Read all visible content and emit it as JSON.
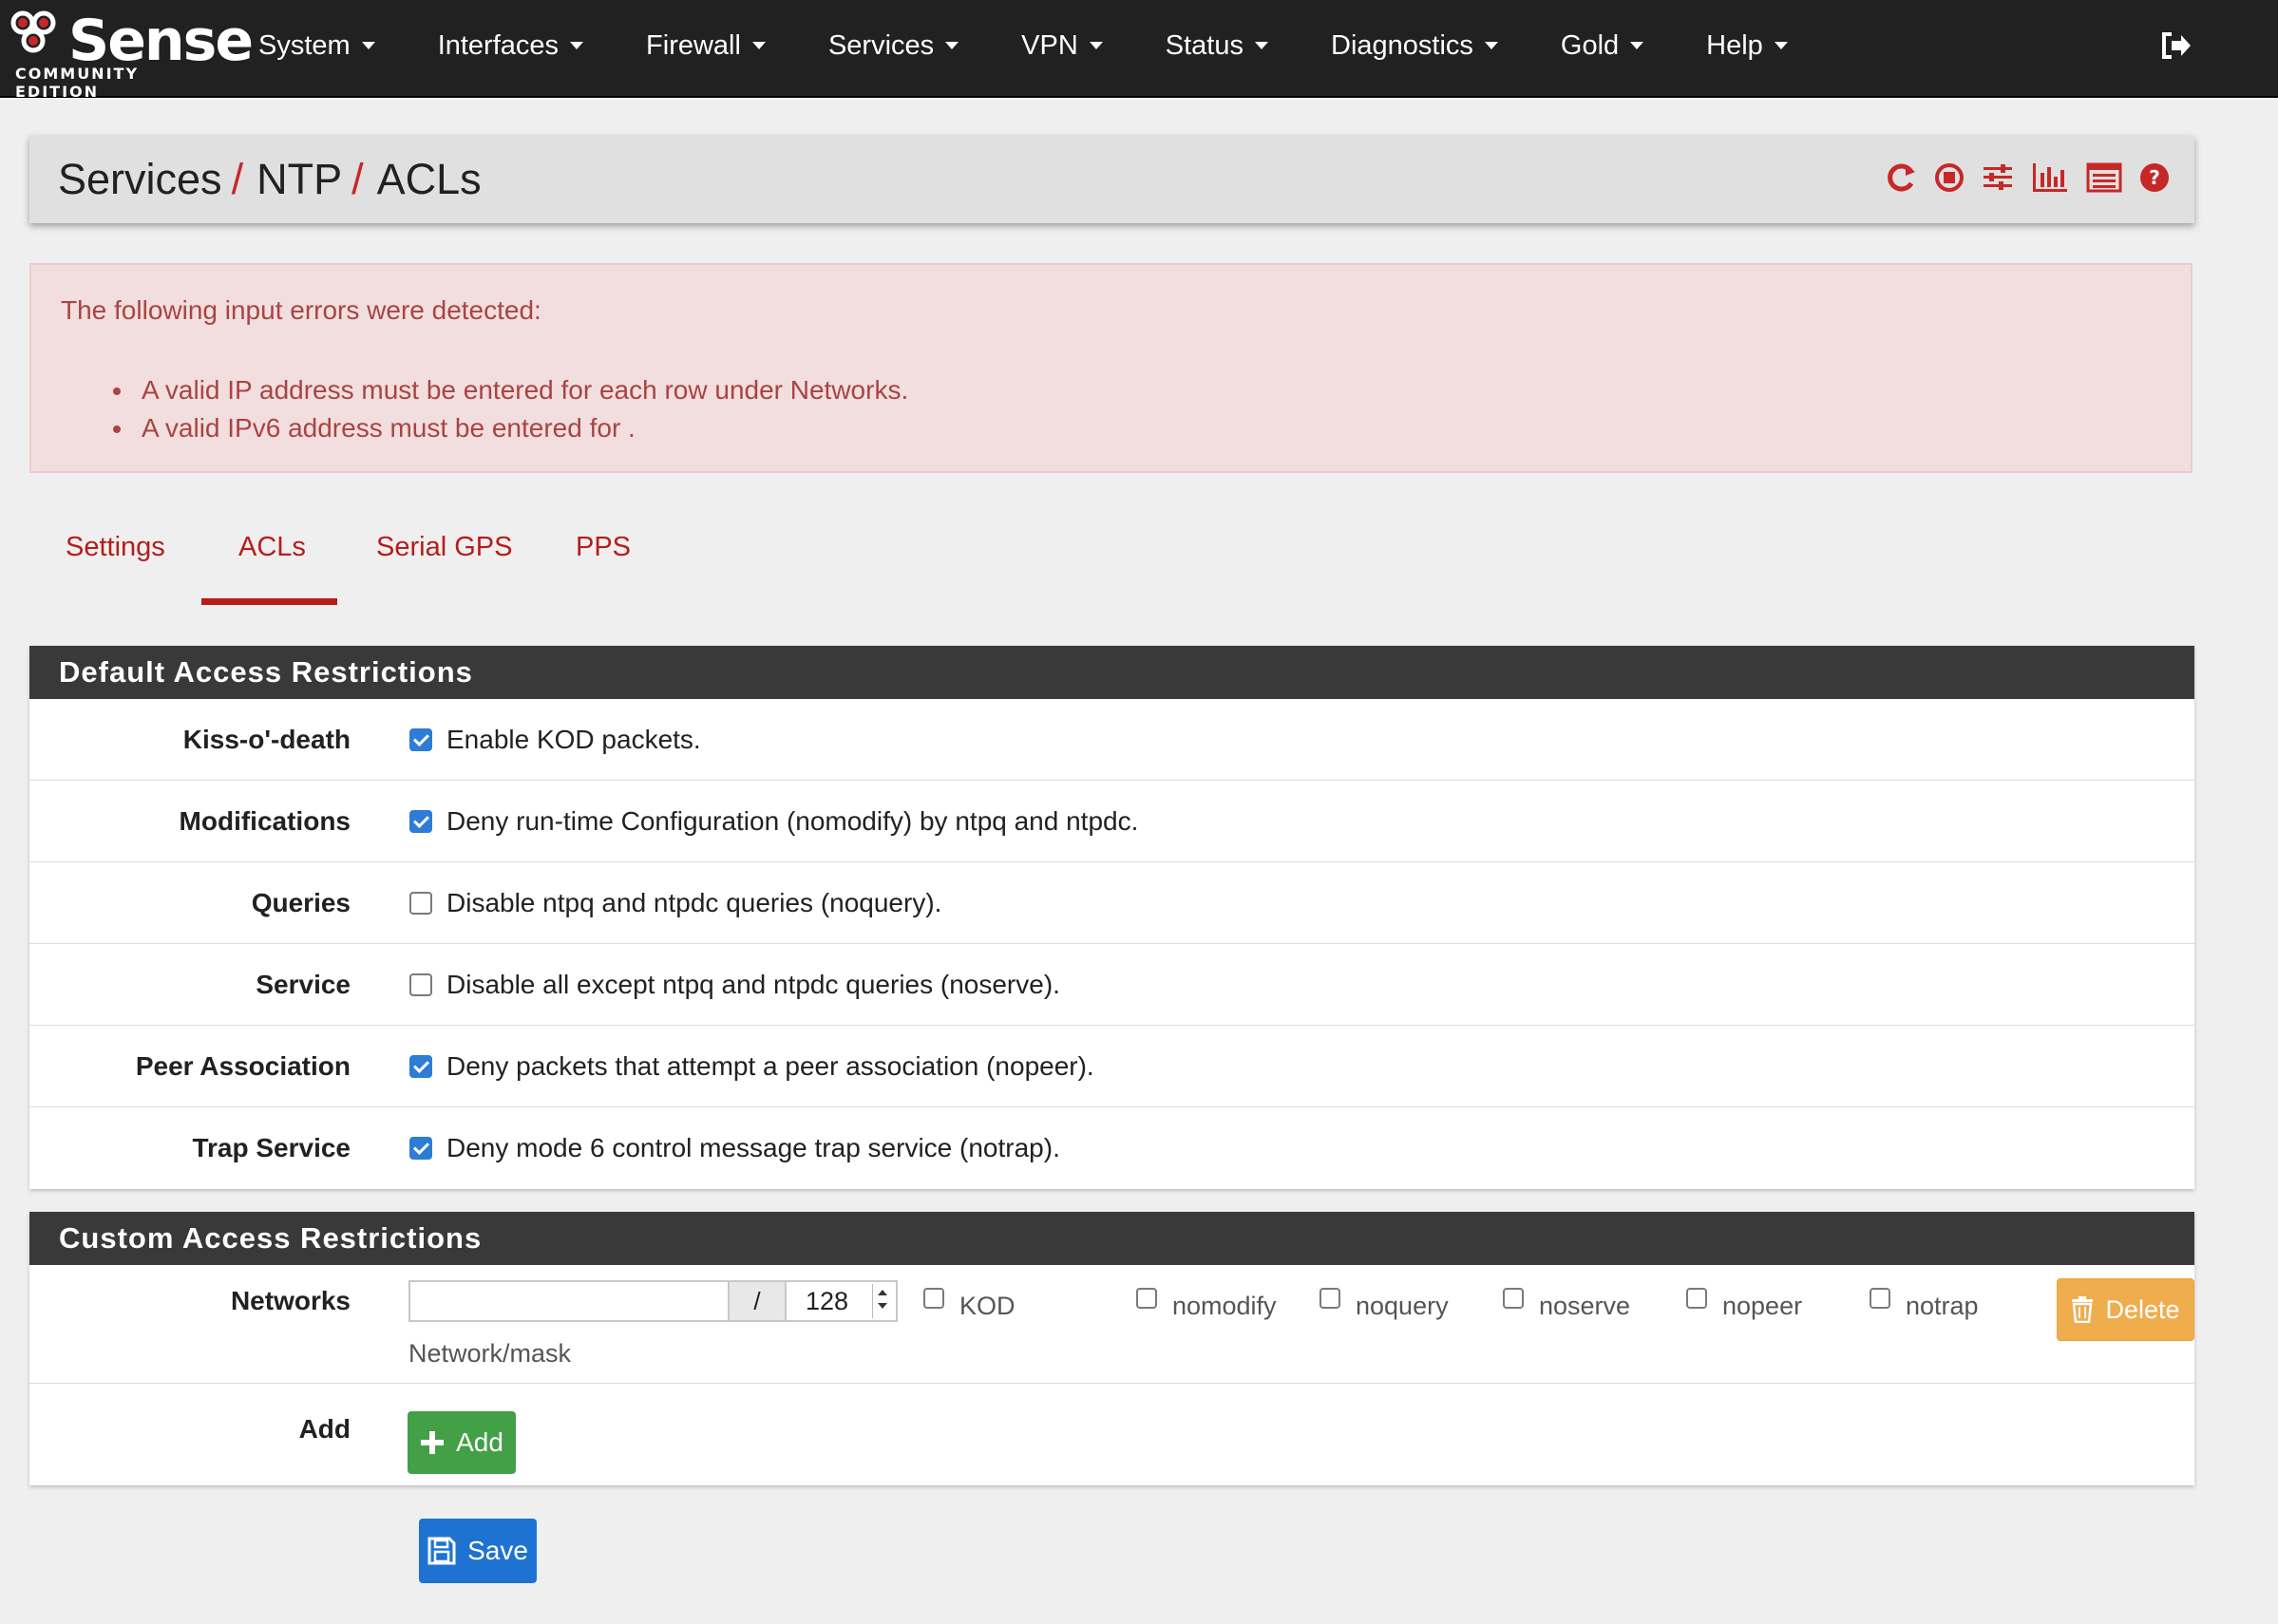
{
  "navbar": {
    "logo_word": "Sense",
    "logo_sub": "COMMUNITY EDITION",
    "menu": [
      "System",
      "Interfaces",
      "Firewall",
      "Services",
      "VPN",
      "Status",
      "Diagnostics",
      "Gold",
      "Help"
    ]
  },
  "breadcrumb": {
    "items": [
      "Services",
      "NTP",
      "ACLs"
    ],
    "separator": "/"
  },
  "alert": {
    "title": "The following input errors were detected:",
    "errors": [
      "A valid IP address must be entered for each row under Networks.",
      "A valid IPv6 address must be entered for ."
    ]
  },
  "tabs": {
    "items": [
      "Settings",
      "ACLs",
      "Serial GPS",
      "PPS"
    ],
    "active": "ACLs"
  },
  "default_panel": {
    "title": "Default Access Restrictions",
    "rows": [
      {
        "label": "Kiss-o'-death",
        "text": "Enable KOD packets.",
        "checked": true
      },
      {
        "label": "Modifications",
        "text": "Deny run-time Configuration (nomodify) by ntpq and ntpdc.",
        "checked": true
      },
      {
        "label": "Queries",
        "text": "Disable ntpq and ntpdc queries (noquery).",
        "checked": false
      },
      {
        "label": "Service",
        "text": "Disable all except ntpq and ntpdc queries (noserve).",
        "checked": false
      },
      {
        "label": "Peer Association",
        "text": "Deny packets that attempt a peer association (nopeer).",
        "checked": true
      },
      {
        "label": "Trap Service",
        "text": "Deny mode 6 control message trap service (notrap).",
        "checked": true
      }
    ]
  },
  "custom_panel": {
    "title": "Custom Access Restrictions",
    "networks": {
      "label": "Networks",
      "value": "",
      "slash": "/",
      "mask": "128",
      "help": "Network/mask",
      "flags": [
        {
          "label": "KOD",
          "checked": false
        },
        {
          "label": "nomodify",
          "checked": false
        },
        {
          "label": "noquery",
          "checked": false
        },
        {
          "label": "noserve",
          "checked": false
        },
        {
          "label": "nopeer",
          "checked": false
        },
        {
          "label": "notrap",
          "checked": false
        }
      ],
      "delete_label": "Delete"
    },
    "add": {
      "label": "Add",
      "button": "Add"
    }
  },
  "save_label": "Save",
  "colors": {
    "accent": "#b71c1c",
    "navbar": "#212121",
    "checkbox": "#2d7cd6",
    "delete": "#f0ad4e",
    "add": "#43a047",
    "save": "#1e73d2"
  },
  "icons": [
    "restart-icon",
    "stop-icon",
    "settings-sliders-icon",
    "chart-icon",
    "log-icon",
    "help-icon",
    "logout-icon",
    "trash-icon",
    "plus-icon",
    "floppy-icon"
  ]
}
